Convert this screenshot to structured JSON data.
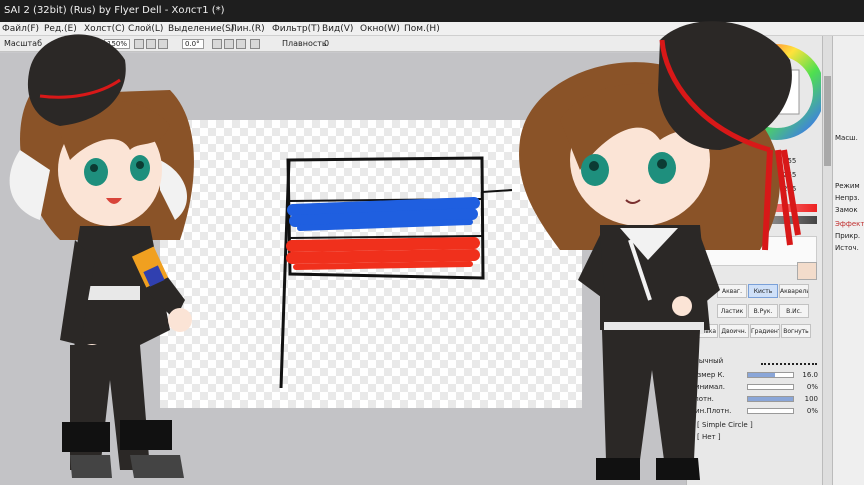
{
  "window": {
    "title": "SAI 2 (32bit) (Rus) by Flyer Dell - Холст1 (*)"
  },
  "menu": [
    {
      "label": "Файл(F)"
    },
    {
      "label": "Ред.(E)"
    },
    {
      "label": "Холст(C)"
    },
    {
      "label": "Слой(L)"
    },
    {
      "label": "Выделение(S)"
    },
    {
      "label": "Лин.(R)"
    },
    {
      "label": "Фильтр(T)"
    },
    {
      "label": "Вид(V)"
    },
    {
      "label": "Окно(W)"
    },
    {
      "label": "Пом.(H)"
    }
  ],
  "toolbar": {
    "zoom_label": "Масштаб",
    "zoom_value": "150%",
    "angle_value": "0.0°",
    "smoothing_label": "Плавность",
    "smoothing_value": "0"
  },
  "color_panel": {
    "rgb_values": [
      "255",
      "255",
      "255"
    ]
  },
  "tools": [
    {
      "label": "Акваг."
    },
    {
      "label": "Кисть"
    },
    {
      "label": "Акварель"
    },
    {
      "label": "Ластик"
    },
    {
      "label": "В.Рук."
    },
    {
      "label": "В.Ис."
    },
    {
      "label": "Заливка"
    },
    {
      "label": "Двоичн."
    },
    {
      "label": "Градиент"
    },
    {
      "label": "Вогнуть"
    }
  ],
  "brush": {
    "mode_value": "Обычный",
    "size_label": "Размер К.",
    "size_value": "16.0",
    "min_size_label": "Минимал.",
    "min_size_value": "0%",
    "min_size_fraction": 0,
    "density_label": "Плотн.",
    "density_value": "100",
    "density_fraction": 1.0,
    "min_density_label": "Мин.Плотн.",
    "min_density_value": "0%",
    "min_density_fraction": 0,
    "shape_value": "[ Simple Circle ]",
    "texture_value": "[ Нет ]"
  },
  "layer_panel": {
    "items": [
      "Масш.",
      "Режим",
      "Непрз.",
      "Замок",
      "Эффект",
      "Прикр.",
      "Источ."
    ]
  },
  "colors": {
    "flag_blue": "#1f5fe0",
    "flag_red": "#f0301c",
    "hat_band": "#d81818",
    "uniform": "#2b2826",
    "hair": "#8a5328",
    "eyes": "#1e8f7d"
  }
}
